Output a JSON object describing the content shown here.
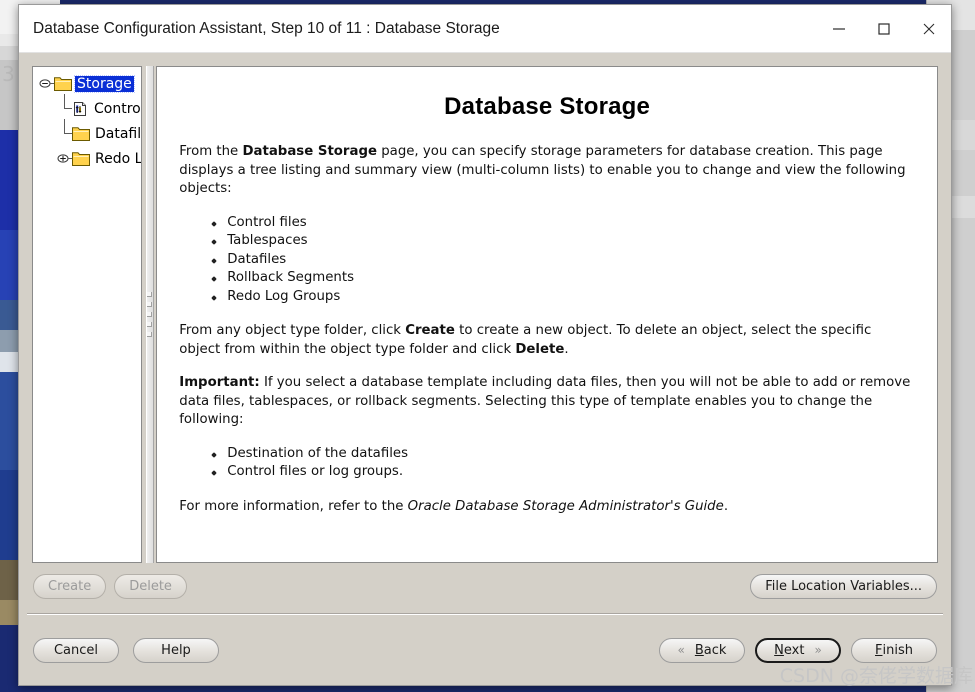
{
  "window": {
    "title": "Database Configuration Assistant, Step 10 of 11 : Database Storage",
    "controls": {
      "minimize": "–",
      "maximize": "❐",
      "close": "✕"
    }
  },
  "tree": {
    "nodes": [
      {
        "label": "Storage",
        "icon": "folder-icon",
        "handle": "collapse-handle",
        "selected": true,
        "level": 0
      },
      {
        "label": "Controlfile",
        "icon": "controlfile-document-icon",
        "handle": "none",
        "selected": false,
        "level": 1
      },
      {
        "label": "Datafiles",
        "icon": "folder-icon",
        "handle": "none",
        "selected": false,
        "level": 1
      },
      {
        "label": "Redo Log Groups",
        "icon": "folder-icon",
        "handle": "expand-handle",
        "selected": false,
        "level": 1
      }
    ]
  },
  "content": {
    "heading": "Database Storage",
    "paragraph1": {
      "part1": "From the ",
      "bold1": "Database Storage",
      "part2": " page, you can specify storage parameters for database creation. This page displays a tree listing and summary view (multi-column lists) to enable you to change and view the following objects:"
    },
    "list1": [
      "Control files",
      "Tablespaces",
      "Datafiles",
      "Rollback Segments",
      "Redo Log Groups"
    ],
    "paragraph2": {
      "part1": "From any object type folder, click ",
      "bold1": "Create",
      "part2": " to create a new object. To delete an object, select the specific object from within the object type folder and click ",
      "bold2": "Delete",
      "part3": "."
    },
    "paragraph3": {
      "bold1": "Important:",
      "part1": " If you select a database template including data files, then you will not be able to add or remove data files, tablespaces, or rollback segments. Selecting this type of template enables you to change the following:"
    },
    "list2": [
      "Destination of the datafiles",
      "Control files or log groups."
    ],
    "paragraph4": {
      "part1": "For more information, refer to the ",
      "italic1": "Oracle Database Storage Administrator's Guide",
      "part2": "."
    }
  },
  "toolbar": {
    "create_label": "Create",
    "create_enabled": false,
    "delete_label": "Delete",
    "delete_enabled": false,
    "file_location_label": "File Location Variables..."
  },
  "footer": {
    "cancel_label": "Cancel",
    "help_label": "Help",
    "back": {
      "mnemonic": "B",
      "rest": "ack"
    },
    "next": {
      "mnemonic": "N",
      "rest": "ext"
    },
    "finish": {
      "mnemonic": "F",
      "rest": "inish"
    },
    "back_chevron": "«",
    "next_chevron": "»",
    "focused_button": "Next"
  },
  "watermark": {
    "text": "CSDN @奈佬学数据库"
  },
  "desktop": {
    "edge_glyph": "6",
    "ghost_char": "3",
    "colors": {
      "window_face": "#d4d0c8",
      "selection_blue": "#0a2fd6",
      "folder_yellow": "#ffd24d",
      "titlebar": "#ffffff",
      "accent_text": "#1b1b1b"
    }
  }
}
